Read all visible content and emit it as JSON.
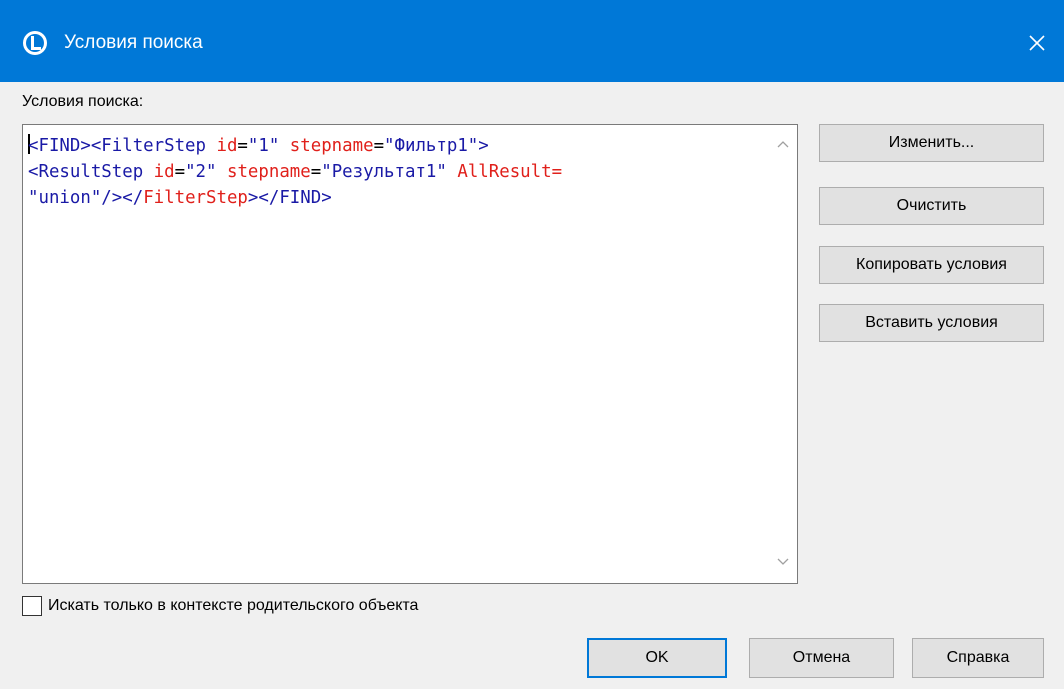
{
  "window": {
    "title": "Условия поиска",
    "icons": {
      "app": "app-logo-icon",
      "close": "close-icon"
    }
  },
  "editor": {
    "label": "Условия поиска:",
    "lines": [
      [
        {
          "t": "tag",
          "s": "<FIND>"
        },
        {
          "t": "tag",
          "s": "<FilterStep "
        },
        {
          "t": "attr",
          "s": "id"
        },
        {
          "t": "plain",
          "s": "="
        },
        {
          "t": "val",
          "s": "\"1\" "
        },
        {
          "t": "attr",
          "s": "stepname"
        },
        {
          "t": "plain",
          "s": "="
        },
        {
          "t": "val",
          "s": "\"Фильтр1\">"
        }
      ],
      [
        {
          "t": "tag",
          "s": "<ResultStep "
        },
        {
          "t": "attr",
          "s": "id"
        },
        {
          "t": "plain",
          "s": "="
        },
        {
          "t": "val",
          "s": "\"2\" "
        },
        {
          "t": "attr",
          "s": "stepname"
        },
        {
          "t": "plain",
          "s": "="
        },
        {
          "t": "val",
          "s": "\"Результат1\" "
        },
        {
          "t": "attr",
          "s": "AllResult="
        }
      ],
      [
        {
          "t": "val",
          "s": "\"union\""
        },
        {
          "t": "tag",
          "s": "/>"
        },
        {
          "t": "tag",
          "s": "</"
        },
        {
          "t": "attr",
          "s": "FilterStep"
        },
        {
          "t": "tag",
          "s": ">"
        },
        {
          "t": "tag",
          "s": "</FIND>"
        }
      ]
    ],
    "scroll_icons": {
      "up": "scroll-up-arrow-icon",
      "down": "scroll-down-arrow-icon"
    }
  },
  "side_buttons": {
    "change": "Изменить...",
    "clear": "Очистить",
    "copy": "Копировать условия",
    "paste": "Вставить условия"
  },
  "checkbox": {
    "label": "Искать только в контексте родительского объекта",
    "checked": false
  },
  "footer_buttons": {
    "ok": "OK",
    "cancel": "Отмена",
    "help": "Справка"
  },
  "colors": {
    "titlebar": "#0078d7",
    "tag": "#1a1aa6",
    "attr": "#e0201b",
    "background": "#f0f0f0"
  }
}
